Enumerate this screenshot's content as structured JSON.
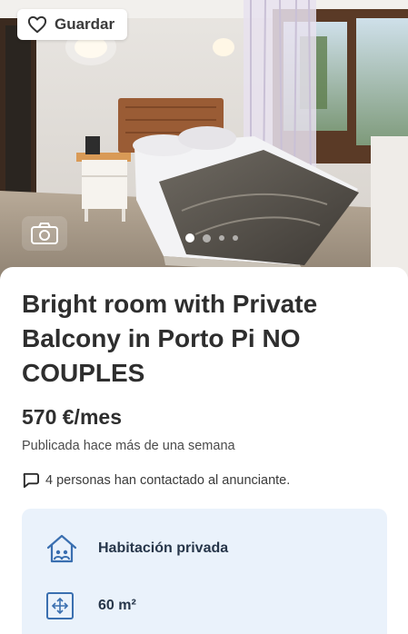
{
  "header": {
    "save_label": "Guardar"
  },
  "gallery": {
    "photo_count_dots": 4,
    "active_index": 0
  },
  "listing": {
    "title": "Bright room with Private Balcony in Porto Pi NO COUPLES",
    "price": "570 €/mes",
    "published": "Publicada hace más de una semana",
    "contacted": "4 personas han contactado al anunciante."
  },
  "features": [
    {
      "icon": "house-icon",
      "label": "Habitación privada"
    },
    {
      "icon": "area-icon",
      "label": "60 m²"
    }
  ],
  "colors": {
    "features_bg": "#eaf2fb",
    "feature_text": "#27364a",
    "icon_blue": "#3a6fb0"
  }
}
